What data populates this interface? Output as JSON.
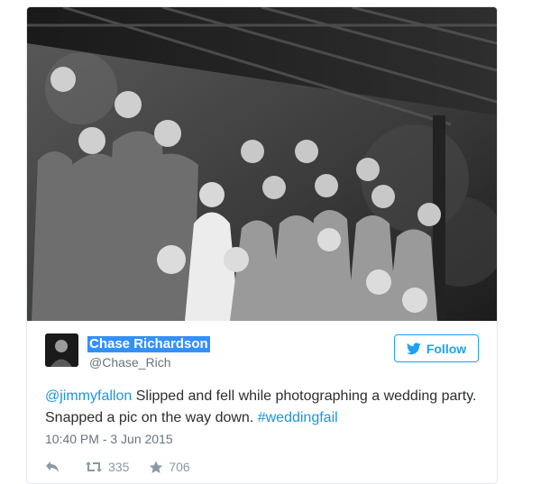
{
  "tweet": {
    "author_name": "Chase Richardson",
    "author_handle": "@Chase_Rich",
    "follow_label": "Follow",
    "mention": "@jimmyfallon",
    "text_middle": " Slipped and fell while photographing a wedding party. Snapped a pic on the way down. ",
    "hashtag": "#weddingfail",
    "timestamp": "10:40 PM - 3 Jun 2015",
    "retweet_count": "335",
    "favorite_count": "706"
  },
  "colors": {
    "accent": "#1da1f2",
    "link": "#1b95e0",
    "selection_highlight": "#3390ff",
    "text": "#292f33",
    "muted": "#66757f"
  },
  "icons": {
    "follow": "bird-icon",
    "reply": "reply-icon",
    "retweet": "retweet-icon",
    "favorite": "star-icon"
  }
}
